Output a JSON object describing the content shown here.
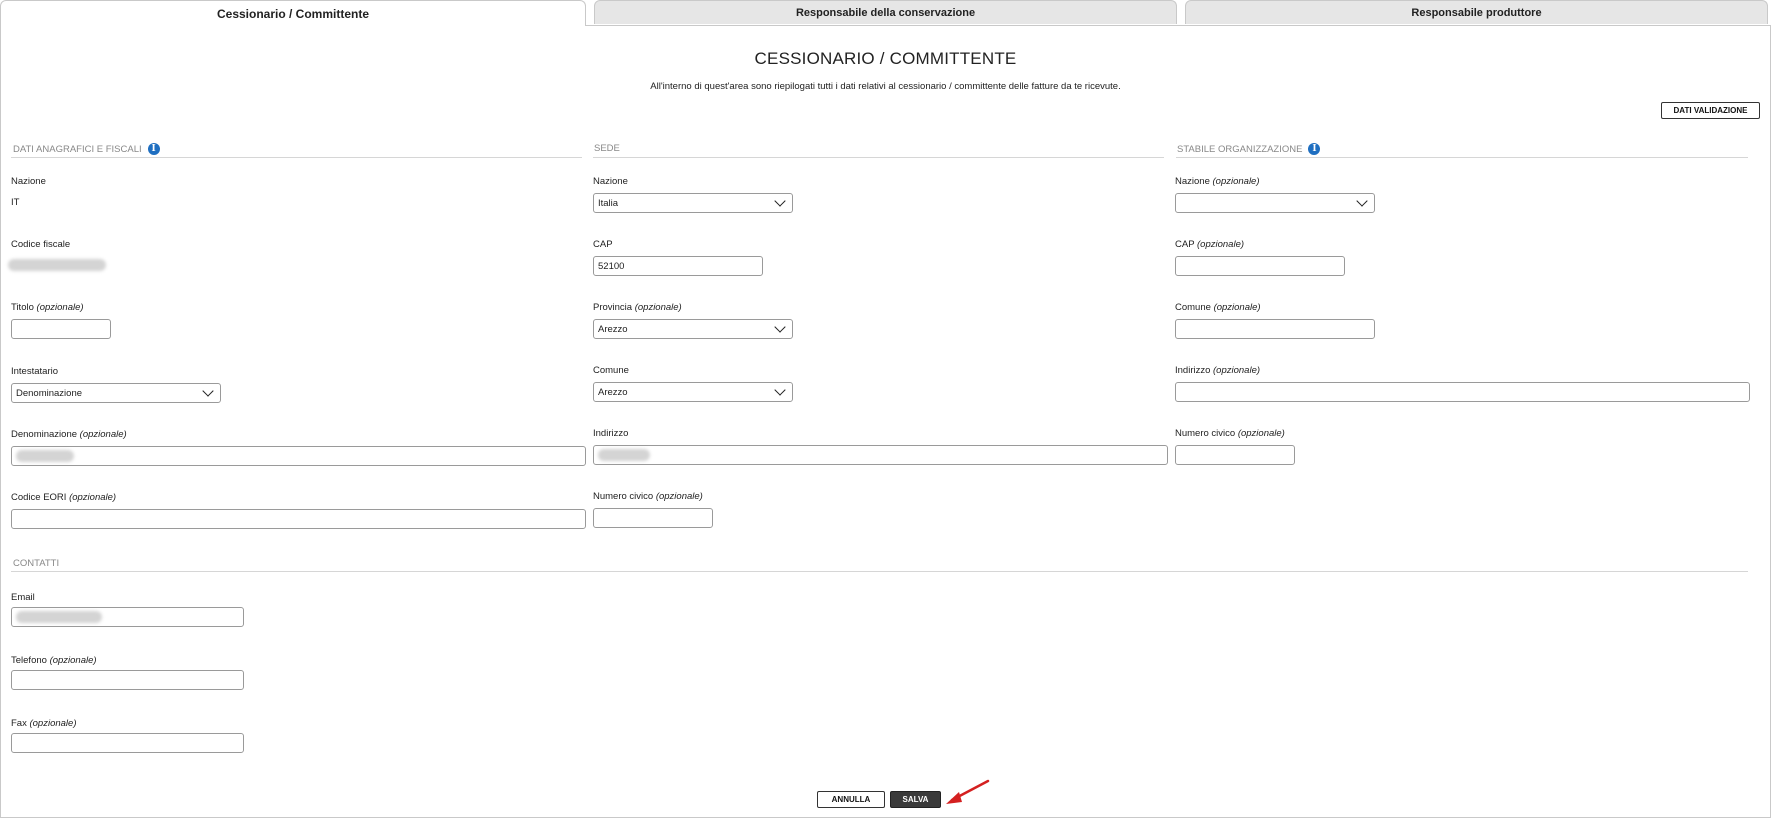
{
  "tabs": [
    {
      "label": "Cessionario / Committente",
      "active": true
    },
    {
      "label": "Responsabile della conservazione",
      "active": false
    },
    {
      "label": "Responsabile produttore",
      "active": false
    }
  ],
  "header": {
    "title": "CESSIONARIO / COMMITTENTE",
    "subtitle": "All'interno di quest'area sono riepilogati tutti i dati relativi al cessionario / committente delle fatture da te ricevute.",
    "validation_button": "DATI VALIDAZIONE"
  },
  "anagrafici": {
    "heading": "DATI ANAGRAFICI E FISCALI",
    "nazione_label": "Nazione",
    "nazione_value": "IT",
    "codice_fiscale_label": "Codice fiscale",
    "titolo_label": "Titolo",
    "intestatario_label": "Intestatario",
    "intestatario_value": "Denominazione",
    "denominazione_label": "Denominazione",
    "codice_eori_label": "Codice EORI"
  },
  "sede": {
    "heading": "SEDE",
    "nazione_label": "Nazione",
    "nazione_value": "Italia",
    "cap_label": "CAP",
    "cap_value": "52100",
    "provincia_label": "Provincia",
    "provincia_value": "Arezzo",
    "comune_label": "Comune",
    "comune_value": "Arezzo",
    "indirizzo_label": "Indirizzo",
    "numero_civico_label": "Numero civico"
  },
  "stabile": {
    "heading": "STABILE ORGANIZZAZIONE",
    "nazione_label": "Nazione",
    "cap_label": "CAP",
    "comune_label": "Comune",
    "indirizzo_label": "Indirizzo",
    "numero_civico_label": "Numero civico"
  },
  "contatti": {
    "heading": "CONTATTI",
    "email_label": "Email",
    "telefono_label": "Telefono",
    "fax_label": "Fax"
  },
  "optional_tag": "(opzionale)",
  "footer": {
    "cancel_label": "ANNULLA",
    "save_label": "SALVA"
  },
  "colors": {
    "info_icon": "#1f6fc1",
    "arrow": "#d42020",
    "save_bg": "#3a3a3a"
  }
}
